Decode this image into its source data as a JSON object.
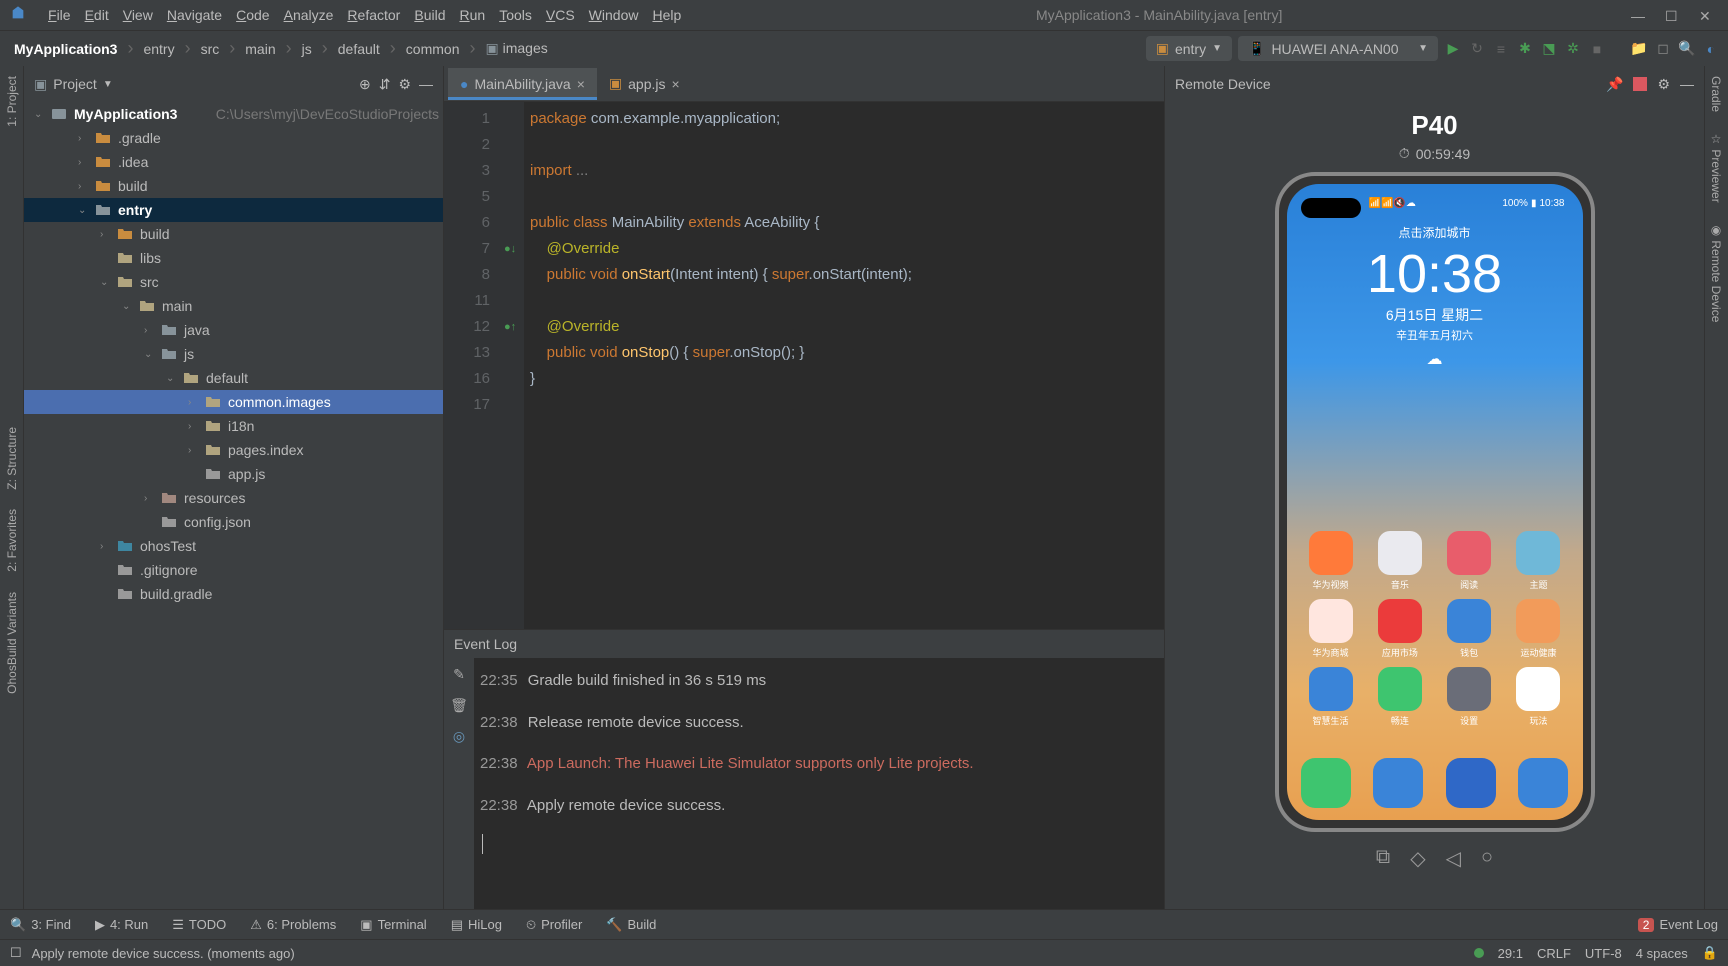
{
  "menu": [
    "File",
    "Edit",
    "View",
    "Navigate",
    "Code",
    "Analyze",
    "Refactor",
    "Build",
    "Run",
    "Tools",
    "VCS",
    "Window",
    "Help"
  ],
  "window_title": "MyApplication3 - MainAbility.java [entry]",
  "breadcrumbs": [
    "MyApplication3",
    "entry",
    "src",
    "main",
    "js",
    "default",
    "common",
    "images"
  ],
  "run_config": "entry",
  "device_selector": "HUAWEI ANA-AN00",
  "project": {
    "panel_title": "Project",
    "root": "MyApplication3",
    "root_path": "C:\\Users\\myj\\DevEcoStudioProjects",
    "nodes": [
      {
        "label": ".gradle",
        "indent": 2,
        "type": "folder-orange",
        "chev": "›"
      },
      {
        "label": ".idea",
        "indent": 2,
        "type": "folder-orange",
        "chev": "›"
      },
      {
        "label": "build",
        "indent": 2,
        "type": "folder-orange",
        "chev": "›"
      },
      {
        "label": "entry",
        "indent": 2,
        "type": "folder-blue",
        "chev": "⌄",
        "bold": true,
        "selrow": true
      },
      {
        "label": "build",
        "indent": 3,
        "type": "folder-orange",
        "chev": "›"
      },
      {
        "label": "libs",
        "indent": 3,
        "type": "folder-gray",
        "chev": ""
      },
      {
        "label": "src",
        "indent": 3,
        "type": "folder-gray",
        "chev": "⌄"
      },
      {
        "label": "main",
        "indent": 4,
        "type": "folder-gray",
        "chev": "⌄"
      },
      {
        "label": "java",
        "indent": 5,
        "type": "folder-blue",
        "chev": "›"
      },
      {
        "label": "js",
        "indent": 5,
        "type": "folder-blue",
        "chev": "⌄"
      },
      {
        "label": "default",
        "indent": 6,
        "type": "folder-gray",
        "chev": "⌄"
      },
      {
        "label": "common.images",
        "indent": 7,
        "type": "folder-gray",
        "chev": "›",
        "sel": true
      },
      {
        "label": "i18n",
        "indent": 7,
        "type": "folder-gray",
        "chev": "›"
      },
      {
        "label": "pages.index",
        "indent": 7,
        "type": "folder-gray",
        "chev": "›"
      },
      {
        "label": "app.js",
        "indent": 7,
        "type": "file-js",
        "chev": ""
      },
      {
        "label": "resources",
        "indent": 5,
        "type": "folder-res",
        "chev": "›"
      },
      {
        "label": "config.json",
        "indent": 5,
        "type": "file-json",
        "chev": ""
      },
      {
        "label": "ohosTest",
        "indent": 3,
        "type": "folder-green",
        "chev": "›"
      },
      {
        "label": ".gitignore",
        "indent": 3,
        "type": "file",
        "chev": ""
      },
      {
        "label": "build.gradle",
        "indent": 3,
        "type": "file-gradle",
        "chev": ""
      }
    ]
  },
  "tabs": [
    {
      "label": "MainAbility.java",
      "active": true,
      "icon": "java"
    },
    {
      "label": "app.js",
      "active": false,
      "icon": "js"
    }
  ],
  "code": {
    "lines": [
      "1",
      "2",
      "3",
      "5",
      "6",
      "7",
      "8",
      "11",
      "12",
      "13",
      "16",
      "17"
    ],
    "content": [
      {
        "t": "package ",
        "c": "kw"
      },
      {
        "t": "com.example.myapplication",
        "c": "cls"
      },
      {
        "t": ";\n\n",
        "c": "cls"
      },
      {
        "t": "import ",
        "c": "kw"
      },
      {
        "t": "...\n\n",
        "c": "dim"
      },
      {
        "t": "public class ",
        "c": "kw"
      },
      {
        "t": "MainAbility ",
        "c": "cls"
      },
      {
        "t": "extends ",
        "c": "kw"
      },
      {
        "t": "AceAbility {\n",
        "c": "cls"
      },
      {
        "t": "    @Override\n",
        "c": "ann"
      },
      {
        "t": "    public void ",
        "c": "kw"
      },
      {
        "t": "onStart",
        "c": "mth"
      },
      {
        "t": "(Intent intent) { ",
        "c": "cls"
      },
      {
        "t": "super",
        "c": "kw"
      },
      {
        "t": ".onStart(intent);\n\n",
        "c": "cls"
      },
      {
        "t": "    @Override\n",
        "c": "ann"
      },
      {
        "t": "    public void ",
        "c": "kw"
      },
      {
        "t": "onStop",
        "c": "mth"
      },
      {
        "t": "() { ",
        "c": "cls"
      },
      {
        "t": "super",
        "c": "kw"
      },
      {
        "t": ".onStop(); }\n",
        "c": "cls"
      },
      {
        "t": "}\n",
        "c": "cls"
      }
    ]
  },
  "remote": {
    "title": "Remote Device",
    "model": "P40",
    "timer": "00:59:49",
    "phone": {
      "city": "点击添加城市",
      "time": "10:38",
      "date": "6月15日 星期二",
      "date2": "辛丑年五月初六",
      "battery": "100%",
      "clock": "10:38",
      "apps": [
        [
          {
            "l": "华为视频",
            "c": "#ff7a3a"
          },
          {
            "l": "音乐",
            "c": "#eaeaef"
          },
          {
            "l": "阅读",
            "c": "#e85d6b"
          },
          {
            "l": "主题",
            "c": "#6fb8d8"
          }
        ],
        [
          {
            "l": "华为商城",
            "c": "#ffe6df"
          },
          {
            "l": "应用市场",
            "c": "#eb3b3b"
          },
          {
            "l": "钱包",
            "c": "#3a84d8"
          },
          {
            "l": "运动健康",
            "c": "#f29b5a"
          }
        ],
        [
          {
            "l": "智慧生活",
            "c": "#3a84d8"
          },
          {
            "l": "畅连",
            "c": "#3ec56f"
          },
          {
            "l": "设置",
            "c": "#6a6d78"
          },
          {
            "l": "玩法",
            "c": "#fff"
          }
        ]
      ],
      "dock": [
        {
          "c": "#3ec56f"
        },
        {
          "c": "#3a84d8"
        },
        {
          "c": "#2f68c7"
        },
        {
          "c": "#3a84d8"
        }
      ]
    }
  },
  "event_log": {
    "title": "Event Log",
    "lines": [
      {
        "time": "22:35",
        "msg": "Gradle build finished in 36 s 519 ms",
        "err": false
      },
      {
        "time": "22:38",
        "msg": "Release remote device success.",
        "err": false
      },
      {
        "time": "22:38",
        "msg": "App Launch: The Huawei Lite Simulator supports only Lite projects.",
        "err": true
      },
      {
        "time": "22:38",
        "msg": "Apply remote device success.",
        "err": false
      }
    ]
  },
  "bottom": {
    "find": "3: Find",
    "run": "4: Run",
    "todo": "TODO",
    "problems": "6: Problems",
    "terminal": "Terminal",
    "hilog": "HiLog",
    "profiler": "Profiler",
    "build": "Build",
    "event_log": "Event Log",
    "badge": "2"
  },
  "status": {
    "msg": "Apply remote device success. (moments ago)",
    "pos": "29:1",
    "lf": "CRLF",
    "enc": "UTF-8",
    "indent": "4 spaces"
  }
}
